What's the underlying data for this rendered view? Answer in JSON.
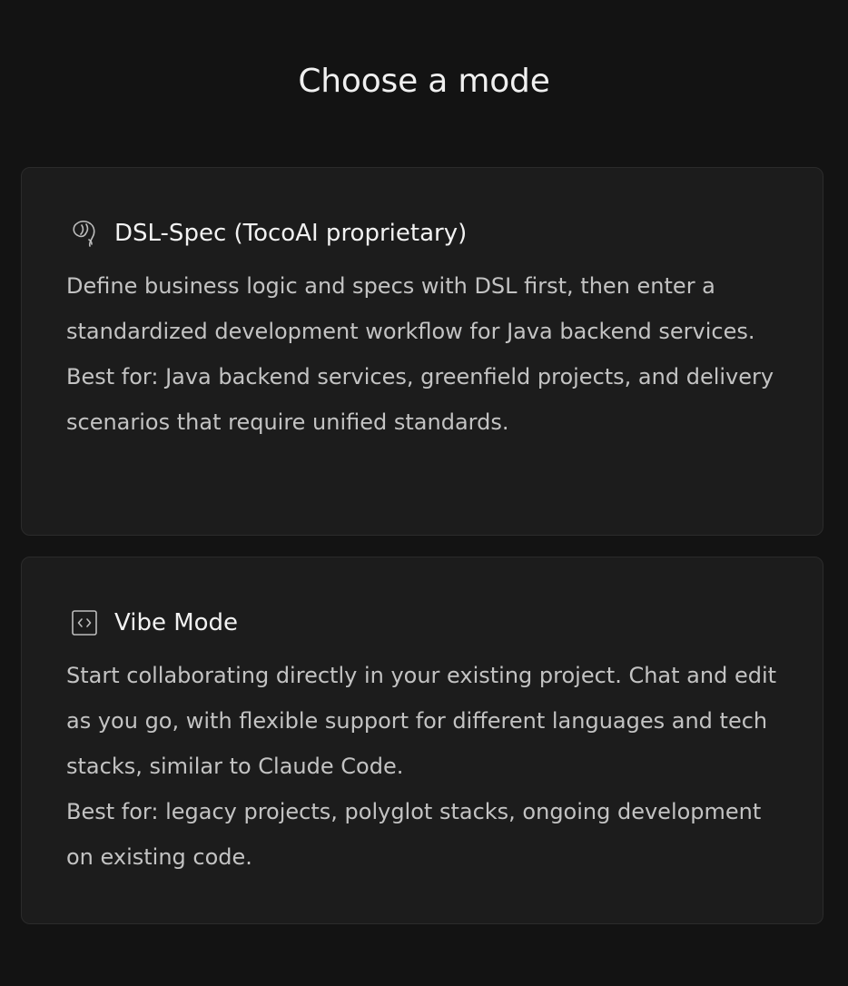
{
  "page": {
    "title": "Choose a mode"
  },
  "modes": [
    {
      "icon": "leaf-bulb-icon",
      "title": "DSL-Spec (TocoAI proprietary)",
      "description": "Define business logic and specs with DSL first, then enter a standardized development workflow for Java backend services.",
      "best_for": "Best for: Java backend services, greenfield projects, and delivery scenarios that require unified standards."
    },
    {
      "icon": "code-brackets-icon",
      "title": "Vibe Mode",
      "description": "Start collaborating directly in your existing project. Chat and edit as you go, with flexible support for different languages and tech stacks, similar to Claude Code.",
      "best_for": "Best for: legacy projects, polyglot stacks, ongoing development on existing code."
    }
  ],
  "colors": {
    "background": "#131313",
    "card": "#1c1c1c",
    "card_border": "#2b2b2b",
    "title_text": "#f0f0f0",
    "body_text": "#c3c3c3"
  }
}
